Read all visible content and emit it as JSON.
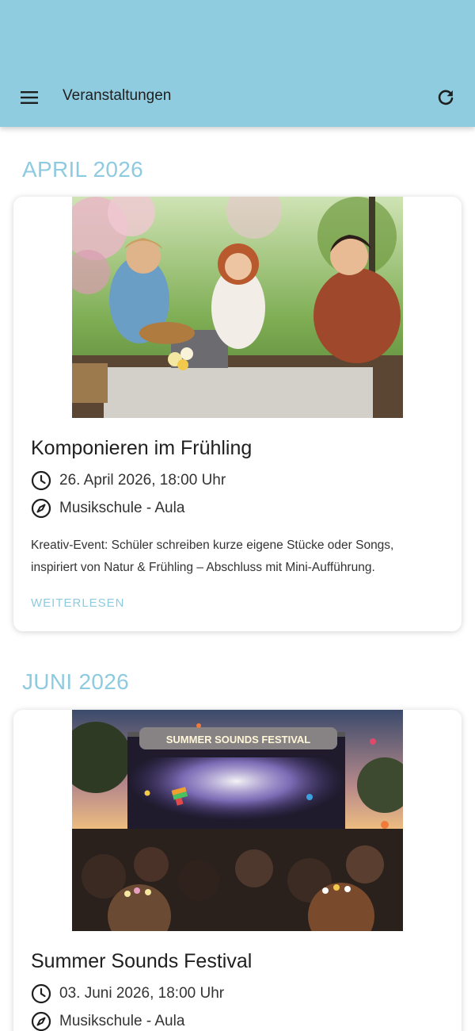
{
  "appbar": {
    "title": "Veranstaltungen",
    "menu_icon": "hamburger-menu-icon",
    "refresh_icon": "refresh-icon",
    "background_color": "#90cce0"
  },
  "accent_color": "#8ecae0",
  "sections": [
    {
      "month": "APRIL 2026",
      "event": {
        "title": "Komponieren im Frühling",
        "datetime": "26. April 2026, 18:00 Uhr",
        "location": "Musikschule - Aula",
        "description": "Kreativ-Event: Schüler schreiben kurze eigene Stücke oder Songs, inspiriert von Natur & Frühling – Abschluss mit Mini-Aufführung.",
        "read_more": "WEITERLESEN"
      }
    },
    {
      "month": "JUNI 2026",
      "event": {
        "title": "Summer Sounds Festival",
        "banner_text": "SUMMER SOUNDS FESTIVAL",
        "datetime": "03. Juni 2026, 18:00 Uhr",
        "location": "Musikschule - Aula"
      }
    }
  ]
}
